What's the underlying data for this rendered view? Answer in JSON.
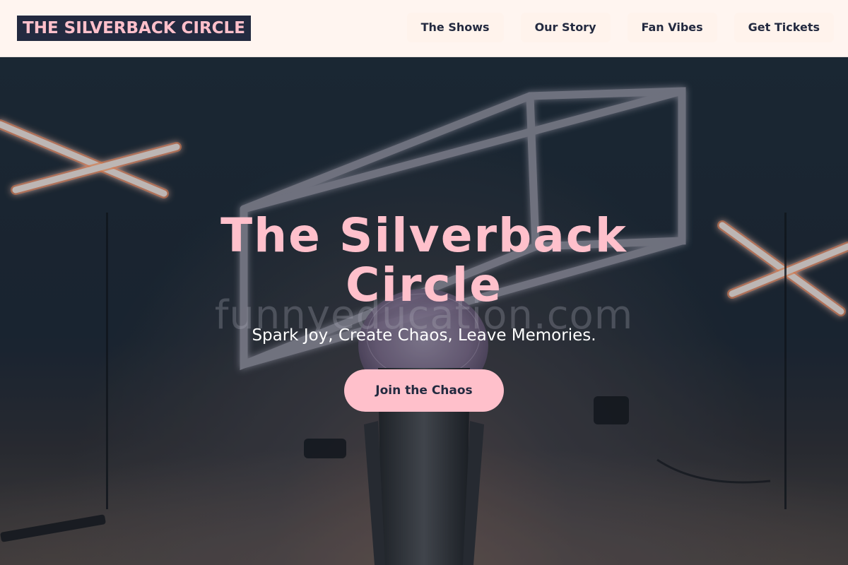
{
  "header": {
    "logo_text": "THE SILVERBACK CIRCLE",
    "nav": [
      {
        "label": "The Shows"
      },
      {
        "label": "Our Story"
      },
      {
        "label": "Fan Vibes"
      },
      {
        "label": "Get Tickets"
      }
    ]
  },
  "hero": {
    "title": "The Silverback Circle",
    "watermark": "funnyeducation.com",
    "subtitle": "Spark Joy, Create Chaos, Leave Memories.",
    "cta_label": "Join the Chaos",
    "background_image_icon": "neon-stage-microphone-image"
  },
  "colors": {
    "accent_pink": "#ffc0cb",
    "navy": "#232a40",
    "header_bg": "#fff5f0"
  }
}
